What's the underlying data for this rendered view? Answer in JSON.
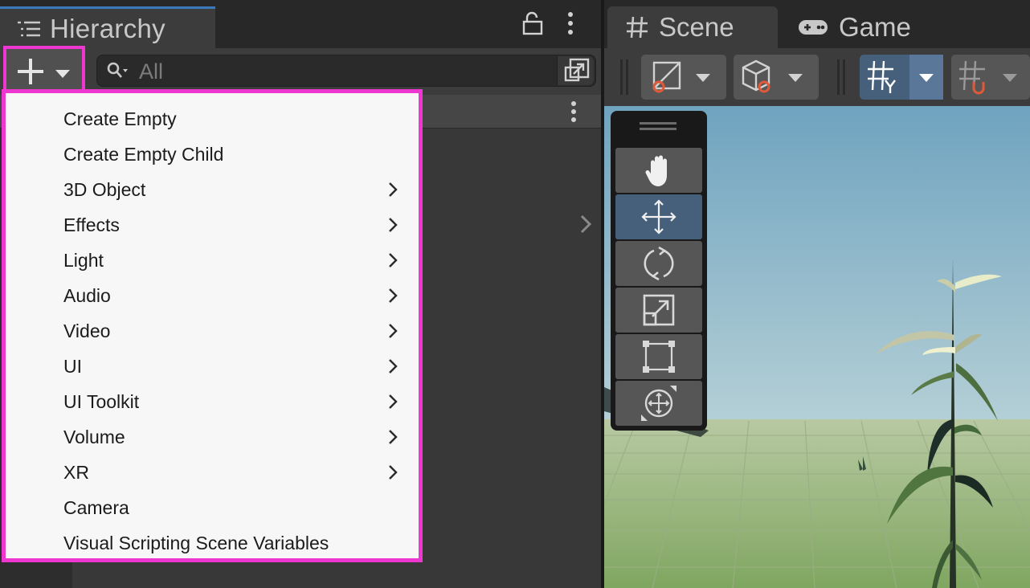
{
  "hierarchy": {
    "title": "Hierarchy",
    "search_placeholder": "All"
  },
  "menu": {
    "items": [
      {
        "label": "Create Empty",
        "submenu": false
      },
      {
        "label": "Create Empty Child",
        "submenu": false
      },
      {
        "label": "3D Object",
        "submenu": true
      },
      {
        "label": "Effects",
        "submenu": true
      },
      {
        "label": "Light",
        "submenu": true
      },
      {
        "label": "Audio",
        "submenu": true
      },
      {
        "label": "Video",
        "submenu": true
      },
      {
        "label": "UI",
        "submenu": true
      },
      {
        "label": "UI Toolkit",
        "submenu": true
      },
      {
        "label": "Volume",
        "submenu": true
      },
      {
        "label": "XR",
        "submenu": true
      },
      {
        "label": "Camera",
        "submenu": false
      },
      {
        "label": "Visual Scripting Scene Variables",
        "submenu": false
      }
    ]
  },
  "scene": {
    "tabs": [
      {
        "label": "Scene",
        "icon": "hash-icon",
        "active": true
      },
      {
        "label": "Game",
        "icon": "gamepad-icon",
        "active": false
      }
    ],
    "tools": [
      "hand-tool",
      "move-tool",
      "rotate-tool",
      "scale-tool",
      "rect-tool",
      "transform-tool"
    ],
    "active_tool": "move-tool"
  },
  "colors": {
    "highlight": "#ee37d0",
    "accent": "#3a79bb",
    "active_button": "#46607c"
  }
}
